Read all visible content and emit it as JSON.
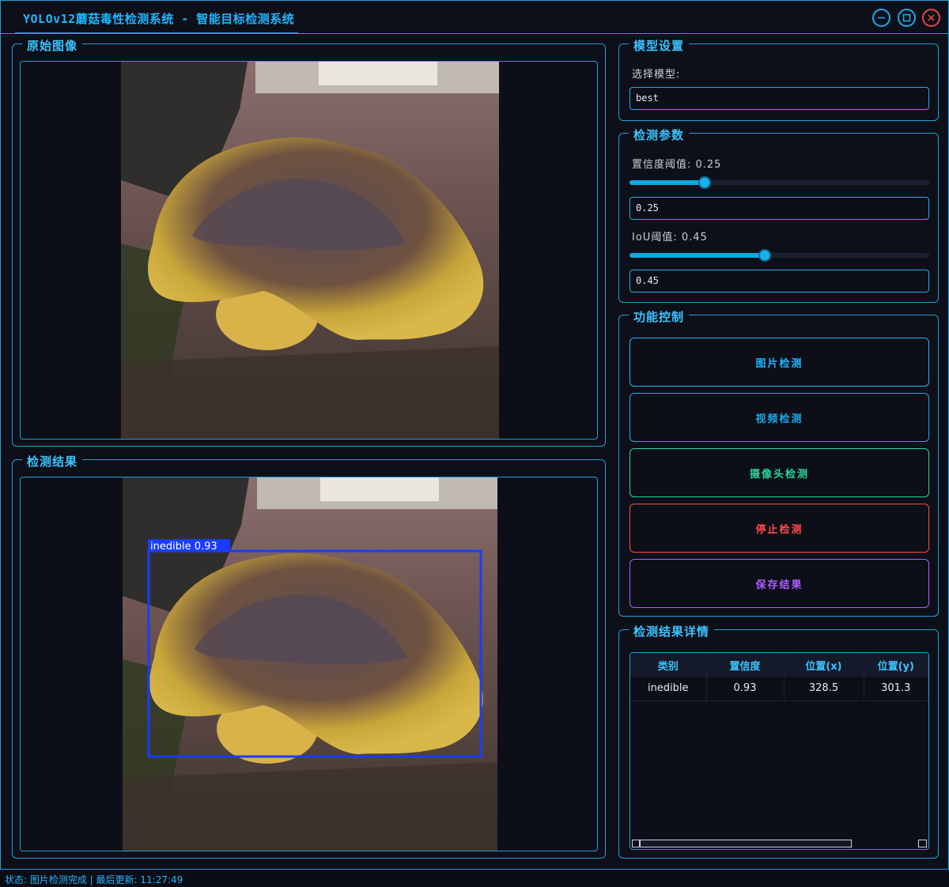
{
  "window": {
    "title": "YOLOv12蘑菇毒性检测系统 - 智能目标检测系统",
    "controls": [
      "minimize",
      "maximize",
      "close"
    ]
  },
  "original_panel": {
    "title": "原始图像"
  },
  "result_panel": {
    "title": "检测结果",
    "detection_label": "inedible 0.93"
  },
  "model_settings": {
    "title": "模型设置",
    "select_label": "选择模型:",
    "selected_model": "best"
  },
  "detection_params": {
    "title": "检测参数",
    "confidence_label": "置信度阈值: 0.25",
    "confidence_value": "0.25",
    "confidence_fraction": 0.25,
    "iou_label": "IoU阈值: 0.45",
    "iou_value": "0.45",
    "iou_fraction": 0.45
  },
  "function_control": {
    "title": "功能控制",
    "buttons": [
      {
        "label": "图片检测",
        "color": "#1fb6ff"
      },
      {
        "label": "视频检测",
        "color": "#1fa8e8"
      },
      {
        "label": "摄像头检测",
        "color": "#2ad69a"
      },
      {
        "label": "停止检测",
        "color": "#ff4a4a"
      },
      {
        "label": "保存结果",
        "color": "#b05cff"
      }
    ]
  },
  "result_details": {
    "title": "检测结果详情",
    "columns": [
      "类别",
      "置信度",
      "位置(x)",
      "位置(y)"
    ],
    "rows": [
      [
        "inedible",
        "0.93",
        "328.5",
        "301.3"
      ]
    ]
  },
  "status_bar": {
    "text": "状态: 图片检测完成 | 最后更新: 11:27:49"
  },
  "colors": {
    "accent": "#1f9fd6",
    "detection_box": "#1a3cff"
  }
}
